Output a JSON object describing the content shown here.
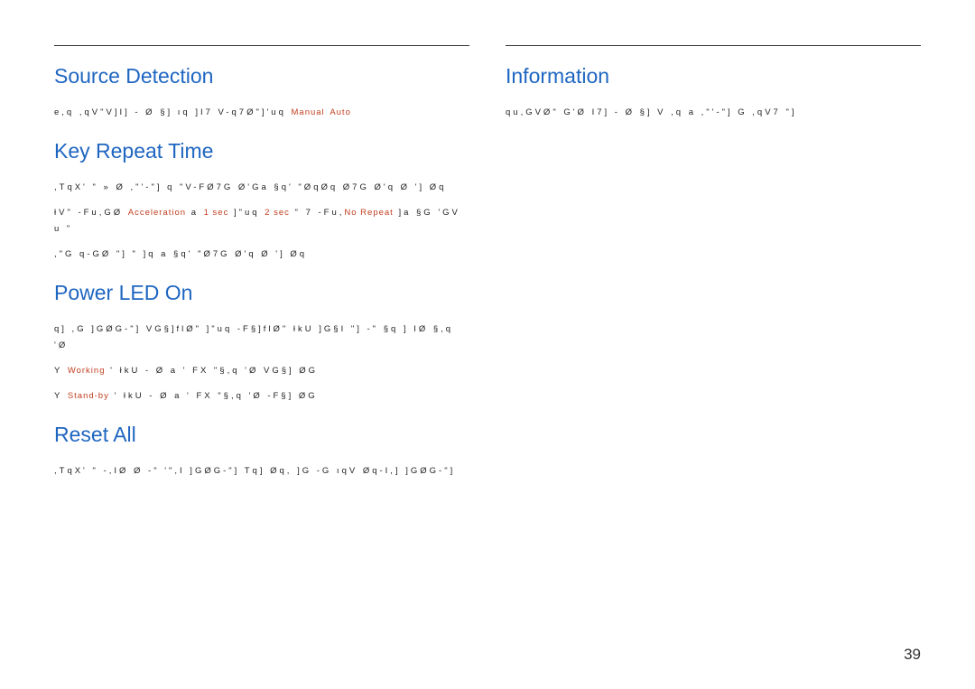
{
  "left": {
    "sections": [
      {
        "title": "Source Detection",
        "lines": [
          [
            {
              "t": "e,q ,qV\"V]I] - Ø §] ıq  ]I7 V-q7Ø\"]'uq "
            },
            {
              "t": "Manual",
              "hl": true
            },
            {
              "t": " "
            },
            {
              "t": "Auto",
              "hl": true
            }
          ]
        ]
      },
      {
        "title": "Key Repeat Time",
        "lines": [
          [
            {
              "t": ",TqX' \" » Ø ,\"'-\"] q \"V-FØ7G Ø'Ga §q' \"ØqØq Ø7G Ø'q Ø '] Øq"
            }
          ],
          [
            {
              "t": "łV\" -Fu,GØ "
            },
            {
              "t": "Acceleration",
              "hl": true
            },
            {
              "t": " a "
            },
            {
              "t": "1 sec",
              "hl": true
            },
            {
              "t": " ]\"uq "
            },
            {
              "t": "2 sec",
              "hl": true
            },
            {
              "t": " \" 7 -Fu,"
            },
            {
              "t": "No Repeat",
              "hl": true
            },
            {
              "t": " ]a §G 'GV u \""
            }
          ],
          [
            {
              "t": ",\"G q-GØ \"] \" ]q a §q' \"Ø7G Ø'q Ø '] Øq"
            }
          ]
        ]
      },
      {
        "title": "Power LED On",
        "lines": [
          [
            {
              "t": "q]  ,G ]GØG-\"] VG§]flØ\" ]\"uq -F§]flØ\" łkU ]G§I \"] -\" §q ] IØ §,q 'Ø"
            }
          ],
          [
            {
              "t": "Y "
            },
            {
              "t": "Working",
              "hl": true
            },
            {
              "t": " ' łkU - Ø a ' FX \"§,q 'Ø VG§] ØG"
            }
          ],
          [
            {
              "t": "Y "
            },
            {
              "t": "Stand-by",
              "hl": true
            },
            {
              "t": " ' łkU - Ø a ' FX \"§,q 'Ø -F§] ØG"
            }
          ]
        ]
      },
      {
        "title": "Reset All",
        "lines": [
          [
            {
              "t": ",TqX' \" -,IØ Ø -\" '\",I ]GØG-\"] Tq] Øq, ]G -G ıqV Øq-I,] ]GØG-\"]"
            }
          ]
        ]
      }
    ]
  },
  "right": {
    "sections": [
      {
        "title": "Information",
        "lines": [
          [
            {
              "t": "qu,GVØ\" G'Ø I7] - Ø §] V ,q a ,\"'-\"] G ,qV7 \"]"
            }
          ]
        ]
      }
    ]
  },
  "pageNumber": "39"
}
